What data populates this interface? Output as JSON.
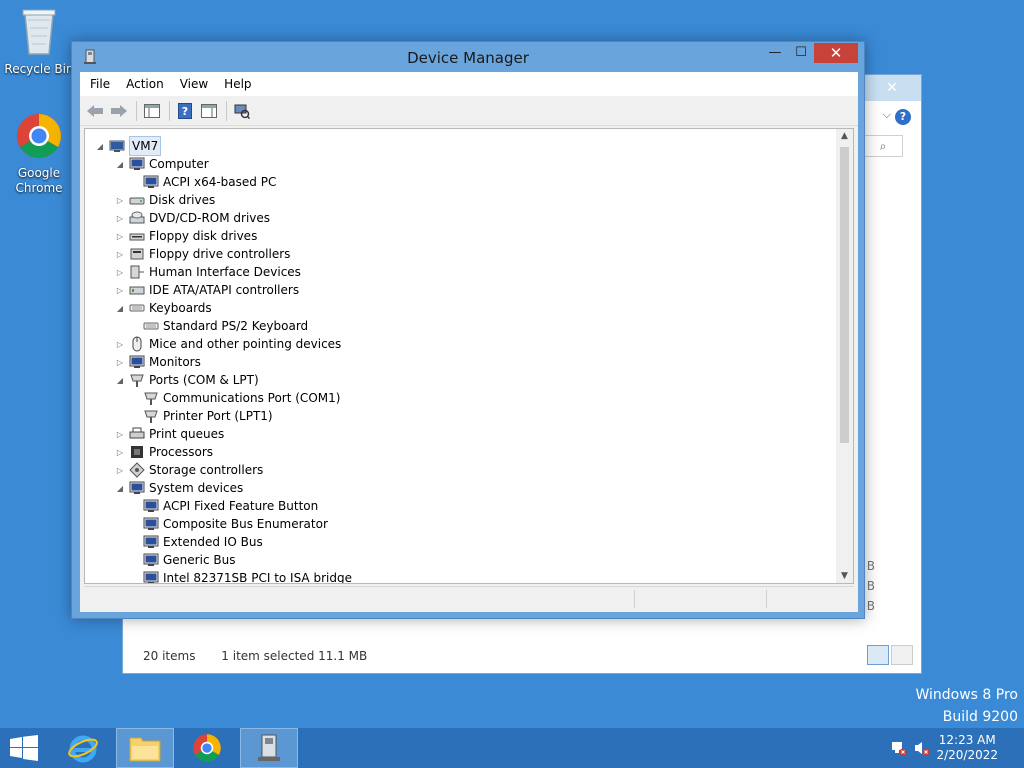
{
  "desktop": {
    "icons": [
      {
        "label": "Recycle Bin"
      },
      {
        "label": "Google Chrome"
      }
    ],
    "watermark": {
      "line1": "Windows 8 Pro",
      "line2": "Build 9200"
    }
  },
  "background_window": {
    "status": {
      "items": "20 items",
      "selected": "1 item selected  11.1 MB"
    },
    "size_labels": [
      "B",
      "B",
      "B"
    ]
  },
  "window": {
    "title": "Device Manager",
    "controls": {
      "minimize": "—",
      "maximize": "☐",
      "close": "✕"
    }
  },
  "menu": [
    "File",
    "Action",
    "View",
    "Help"
  ],
  "tree": [
    {
      "label": "VM7",
      "level": 0,
      "expanded": true,
      "icon": "computer-icon",
      "selected": true
    },
    {
      "label": "Computer",
      "level": 1,
      "expanded": true,
      "icon": "monitor-icon"
    },
    {
      "label": "ACPI x64-based PC",
      "level": 2,
      "icon": "monitor-icon"
    },
    {
      "label": "Disk drives",
      "level": 1,
      "expanded": false,
      "icon": "disk-drive-icon"
    },
    {
      "label": "DVD/CD-ROM drives",
      "level": 1,
      "expanded": false,
      "icon": "dvd-drive-icon"
    },
    {
      "label": "Floppy disk drives",
      "level": 1,
      "expanded": false,
      "icon": "floppy-icon"
    },
    {
      "label": "Floppy drive controllers",
      "level": 1,
      "expanded": false,
      "icon": "controller-icon"
    },
    {
      "label": "Human Interface Devices",
      "level": 1,
      "expanded": false,
      "icon": "hid-icon"
    },
    {
      "label": "IDE ATA/ATAPI controllers",
      "level": 1,
      "expanded": false,
      "icon": "ide-icon"
    },
    {
      "label": "Keyboards",
      "level": 1,
      "expanded": true,
      "icon": "keyboard-icon"
    },
    {
      "label": "Standard PS/2 Keyboard",
      "level": 2,
      "icon": "keyboard-icon"
    },
    {
      "label": "Mice and other pointing devices",
      "level": 1,
      "expanded": false,
      "icon": "mouse-icon"
    },
    {
      "label": "Monitors",
      "level": 1,
      "expanded": false,
      "icon": "monitor-icon"
    },
    {
      "label": "Ports (COM & LPT)",
      "level": 1,
      "expanded": true,
      "icon": "port-icon"
    },
    {
      "label": "Communications Port (COM1)",
      "level": 2,
      "icon": "port-icon"
    },
    {
      "label": "Printer Port (LPT1)",
      "level": 2,
      "icon": "port-icon"
    },
    {
      "label": "Print queues",
      "level": 1,
      "expanded": false,
      "icon": "printer-icon"
    },
    {
      "label": "Processors",
      "level": 1,
      "expanded": false,
      "icon": "processor-icon"
    },
    {
      "label": "Storage controllers",
      "level": 1,
      "expanded": false,
      "icon": "storage-icon"
    },
    {
      "label": "System devices",
      "level": 1,
      "expanded": true,
      "icon": "monitor-icon"
    },
    {
      "label": "ACPI Fixed Feature Button",
      "level": 2,
      "icon": "monitor-icon"
    },
    {
      "label": "Composite Bus Enumerator",
      "level": 2,
      "icon": "monitor-icon"
    },
    {
      "label": "Extended IO Bus",
      "level": 2,
      "icon": "monitor-icon"
    },
    {
      "label": "Generic Bus",
      "level": 2,
      "icon": "monitor-icon"
    },
    {
      "label": "Intel 82371SB PCI to ISA bridge",
      "level": 2,
      "icon": "monitor-icon"
    }
  ],
  "taskbar": {
    "clock": {
      "time": "12:23 AM",
      "date": "2/20/2022"
    }
  },
  "colors": {
    "desktop": "#3a8ad6",
    "window_frame": "#6aa4dd",
    "close_button": "#c74238",
    "taskbar": "#2b70b8"
  }
}
